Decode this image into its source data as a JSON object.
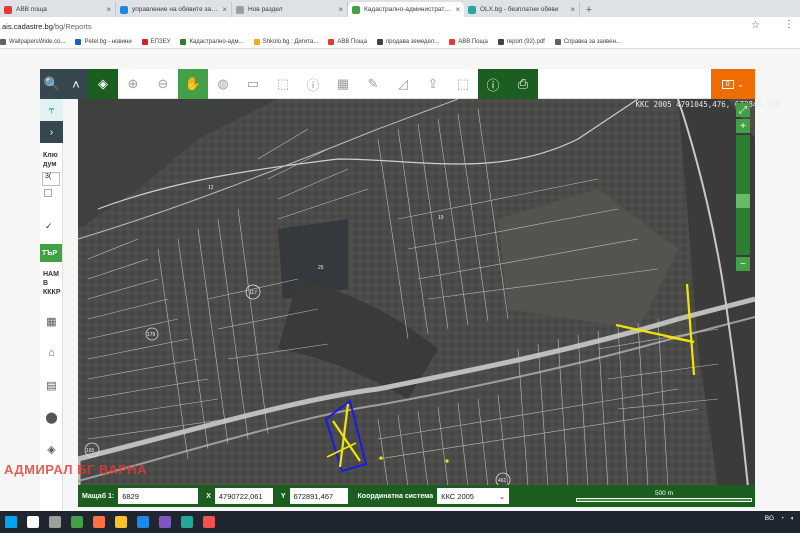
{
  "browser": {
    "tabs": [
      {
        "label": "ABB поща",
        "color": "#e53935",
        "active": false
      },
      {
        "label": "управление на обявите за зем...",
        "color": "#1e88e5",
        "active": false
      },
      {
        "label": "Нов раздел",
        "color": "#9e9e9e",
        "active": false
      },
      {
        "label": "Кадастрално-административна...",
        "color": "#43a047",
        "active": true
      },
      {
        "label": "OLX.bg - безплатни обяви",
        "color": "#26a69a",
        "active": false
      }
    ],
    "new_tab_glyph": "+",
    "url_host": "ais.cadastre.bg",
    "url_path": "/bg/Reports",
    "bookmarks": [
      {
        "label": "WallpapersWide.co...",
        "color": "#616161"
      },
      {
        "label": "Petel.bg - новини",
        "color": "#1565c0"
      },
      {
        "label": "ЕПЗЕУ",
        "color": "#c62828"
      },
      {
        "label": "Кадастрално-адм...",
        "color": "#2e7d32"
      },
      {
        "label": "Shkolo.bg : Дигита...",
        "color": "#f9a825"
      },
      {
        "label": "ABB Поща",
        "color": "#e53935"
      },
      {
        "label": "продава земедел...",
        "color": "#424242"
      },
      {
        "label": "ABB Поща",
        "color": "#e53935"
      },
      {
        "label": "report (92).pdf",
        "color": "#424242"
      },
      {
        "label": "Справка за заявен...",
        "color": "#616161"
      }
    ]
  },
  "toolbar": {
    "buttons": [
      {
        "icon": "search-icon",
        "glyph": "🔍",
        "style": "dark"
      },
      {
        "icon": "chevron-up-icon",
        "glyph": "˄",
        "style": "dark"
      },
      {
        "icon": "layers-icon",
        "glyph": "◈",
        "style": "pin"
      },
      {
        "icon": "zoom-in-icon",
        "glyph": "⊕",
        "style": ""
      },
      {
        "icon": "zoom-out-icon",
        "glyph": "⊖",
        "style": ""
      },
      {
        "icon": "pan-hand-icon",
        "glyph": "✋",
        "style": "green"
      },
      {
        "icon": "globe-icon",
        "glyph": "◍",
        "style": ""
      },
      {
        "icon": "add-rect-icon",
        "glyph": "▭",
        "style": ""
      },
      {
        "icon": "edit-rect-icon",
        "glyph": "⬚",
        "style": ""
      },
      {
        "icon": "info-icon",
        "glyph": "ⓘ",
        "style": ""
      },
      {
        "icon": "grid-info-icon",
        "glyph": "▦",
        "style": ""
      },
      {
        "icon": "measure-icon",
        "glyph": "✎",
        "style": ""
      },
      {
        "icon": "area-icon",
        "glyph": "◿",
        "style": ""
      },
      {
        "icon": "upload-icon",
        "glyph": "⇪",
        "style": ""
      },
      {
        "icon": "select-icon",
        "glyph": "⬚",
        "style": ""
      },
      {
        "icon": "identify-layers-icon",
        "glyph": "ⓘ",
        "style": "pin"
      },
      {
        "icon": "print-icon",
        "glyph": "⎙",
        "style": "pin"
      }
    ],
    "account_badge": "0"
  },
  "sidebar": {
    "lines": [
      "Клю",
      "дум"
    ],
    "search_value": "3(",
    "check_glyph": "✓",
    "action_label": "ТЪР",
    "section_lines": [
      "НАМ",
      "В",
      "КККР"
    ],
    "icons": [
      "grid-icon",
      "home-icon",
      "calculator-icon",
      "marker-icon",
      "layers-stack-icon"
    ]
  },
  "map": {
    "coords": "ККС 2005 4791045,476, 673848,764",
    "zoom_level": 0.44,
    "parcels": [
      "117",
      "179",
      "165",
      "461",
      "25",
      "12",
      "19"
    ]
  },
  "statusbar": {
    "scale_label": "Мащаб 1:",
    "scale_value": "6829",
    "x_label": "X",
    "x_value": "4790722,061",
    "y_label": "Y",
    "y_value": "672891,467",
    "crs_label": "Координатна система",
    "crs_value": "ККС 2005",
    "scalebar_label": "500 m"
  },
  "watermark": "АДМИРАЛ БГ ВАРНА",
  "taskbar": {
    "apps": [
      {
        "icon": "windows-start-icon",
        "color": "#00a4ef"
      },
      {
        "icon": "search-icon",
        "color": "#ffffff"
      },
      {
        "icon": "task-view-icon",
        "color": "#9e9e9e"
      },
      {
        "icon": "chrome-icon",
        "color": "#43a047"
      },
      {
        "icon": "firefox-icon",
        "color": "#ff7043"
      },
      {
        "icon": "explorer-icon",
        "color": "#fbc02d"
      },
      {
        "icon": "word-icon",
        "color": "#1e88e5"
      },
      {
        "icon": "viber-icon",
        "color": "#7e57c2"
      },
      {
        "icon": "photos-icon",
        "color": "#26a69a"
      },
      {
        "icon": "paint-icon",
        "color": "#ef5350"
      }
    ],
    "lang": "BG"
  }
}
